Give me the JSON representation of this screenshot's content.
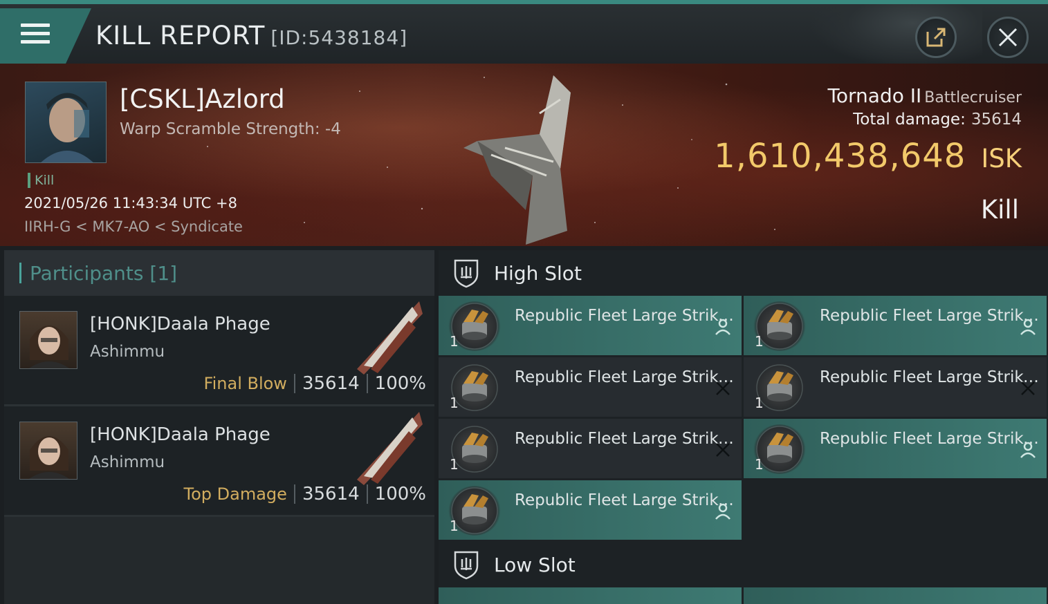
{
  "header": {
    "title": "KILL REPORT",
    "report_id": "[ID:5438184]"
  },
  "victim": {
    "name": "[CSKL]Azlord",
    "warp_scramble": "Warp Scramble Strength: -4",
    "tag": "Kill",
    "datetime": "2021/05/26 11:43:34 UTC +8",
    "location": "IIRH-G < MK7-AO < Syndicate",
    "ship": "Tornado II",
    "ship_class": "Battlecruiser",
    "total_damage_label": "Total damage:",
    "total_damage": "35614",
    "isk_value": "1,610,438,648",
    "isk_unit": "ISK",
    "result": "Kill"
  },
  "participants": {
    "label": "Participants",
    "count": "[1]",
    "items": [
      {
        "name": "[HONK]Daala Phage",
        "ship": "Ashimmu",
        "role": "Final Blow",
        "damage": "35614",
        "percent": "100%"
      },
      {
        "name": "[HONK]Daala Phage",
        "ship": "Ashimmu",
        "role": "Top Damage",
        "damage": "35614",
        "percent": "100%"
      }
    ]
  },
  "fitting": {
    "high_slot_label": "High Slot",
    "low_slot_label": "Low Slot",
    "high_slot_modules": [
      {
        "name": "Republic Fleet Large Strike...",
        "qty": "1",
        "status": "dropped"
      },
      {
        "name": "Republic Fleet Large Strike...",
        "qty": "1",
        "status": "dropped"
      },
      {
        "name": "Republic Fleet Large Strike...",
        "qty": "1",
        "status": "destroyed"
      },
      {
        "name": "Republic Fleet Large Strike...",
        "qty": "1",
        "status": "destroyed"
      },
      {
        "name": "Republic Fleet Large Strike...",
        "qty": "1",
        "status": "destroyed"
      },
      {
        "name": "Republic Fleet Large Strike...",
        "qty": "1",
        "status": "dropped"
      },
      {
        "name": "Republic Fleet Large Strike...",
        "qty": "1",
        "status": "dropped"
      }
    ]
  },
  "colors": {
    "accent": "#3a8a80",
    "isk": "#f2c96a",
    "role": "#d2ad5f",
    "dropped_bg": "#3e7a73"
  },
  "icons": {
    "menu": "menu-icon",
    "share": "share-icon",
    "close": "close-icon",
    "slot": "shield-icon",
    "dropped": "person-icon",
    "destroyed": "x-icon"
  }
}
